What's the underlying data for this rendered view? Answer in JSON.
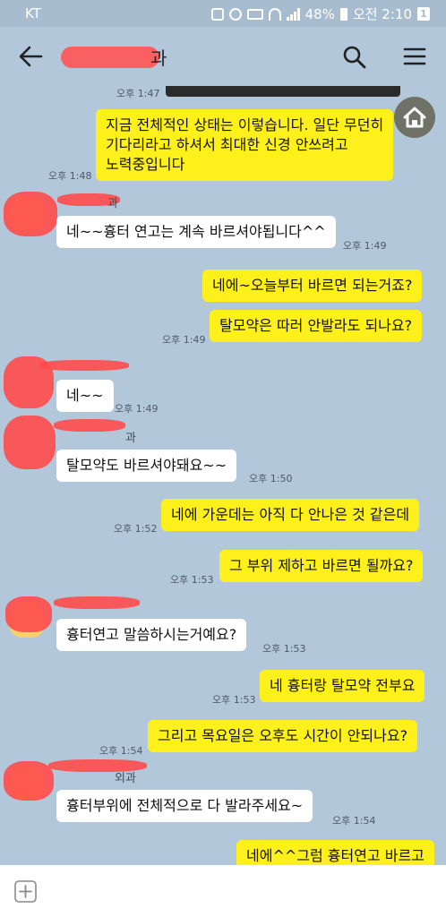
{
  "status_bar": {
    "carrier": "KT",
    "battery": "48%",
    "time": "오전 2:10",
    "notification_count": "1"
  },
  "header": {
    "title_visible": "과"
  },
  "messages": [
    {
      "id": "t0",
      "type": "time",
      "text": "오후 1:47"
    },
    {
      "id": "m1",
      "type": "me",
      "text": "지금 전체적인 상태는 이렇습니다. 일단 무던히\n기다리라고 하셔서 최대한 신경 안쓰려고\n노력중입니다"
    },
    {
      "id": "t1",
      "type": "time",
      "text": "오후 1:48"
    },
    {
      "id": "s1",
      "type": "sender",
      "text": "과"
    },
    {
      "id": "m2",
      "type": "them",
      "text": "네~~흉터 연고는 계속 바르셔야됩니다^^"
    },
    {
      "id": "t2",
      "type": "time",
      "text": "오후 1:49"
    },
    {
      "id": "m3",
      "type": "me",
      "text": "네에~오늘부터 바르면 되는거죠?"
    },
    {
      "id": "m4",
      "type": "me",
      "text": "탈모약은 따러 안발라도 되나요?"
    },
    {
      "id": "t3",
      "type": "time",
      "text": "오후 1:49"
    },
    {
      "id": "m5",
      "type": "them",
      "text": "네~~"
    },
    {
      "id": "t4",
      "type": "time",
      "text": "오후 1:49"
    },
    {
      "id": "s2",
      "type": "sender",
      "text": "과"
    },
    {
      "id": "m6",
      "type": "them",
      "text": "탈모약도 바르셔야돼요~~"
    },
    {
      "id": "t5",
      "type": "time",
      "text": "오후 1:50"
    },
    {
      "id": "m7",
      "type": "me",
      "text": "네에 가운데는 아직 다 안나은 것 같은데"
    },
    {
      "id": "t6",
      "type": "time",
      "text": "오후 1:52"
    },
    {
      "id": "m8",
      "type": "me",
      "text": "그 부위 제하고 바르면 될까요?"
    },
    {
      "id": "t7",
      "type": "time",
      "text": "오후 1:53"
    },
    {
      "id": "m9",
      "type": "them",
      "text": "흉터연고 말씀하시는거예요?"
    },
    {
      "id": "t8",
      "type": "time",
      "text": "오후 1:53"
    },
    {
      "id": "m10",
      "type": "me",
      "text": "네 흉터랑 탈모약 전부요"
    },
    {
      "id": "t9",
      "type": "time",
      "text": "오후 1:53"
    },
    {
      "id": "m11",
      "type": "me",
      "text": "그리고 목요일은 오후도 시간이 안되나요?"
    },
    {
      "id": "t10",
      "type": "time",
      "text": "오후 1:54"
    },
    {
      "id": "s3",
      "type": "sender",
      "text": "외과"
    },
    {
      "id": "m12",
      "type": "them",
      "text": "흉터부위에 전체적으로 다 발라주세요~"
    },
    {
      "id": "t11",
      "type": "time",
      "text": "오후 1:54"
    },
    {
      "id": "m13",
      "type": "me",
      "text": "네에^^그럼 흉터연고 바르고"
    }
  ],
  "icons": {
    "back": "back-arrow-icon",
    "search": "search-icon",
    "menu": "hamburger-menu-icon",
    "home": "home-icon",
    "add": "plus-icon"
  },
  "colors": {
    "background": "#b2c7da",
    "my_bubble": "#fef01b",
    "their_bubble": "#ffffff",
    "redaction": "#ff5757"
  }
}
